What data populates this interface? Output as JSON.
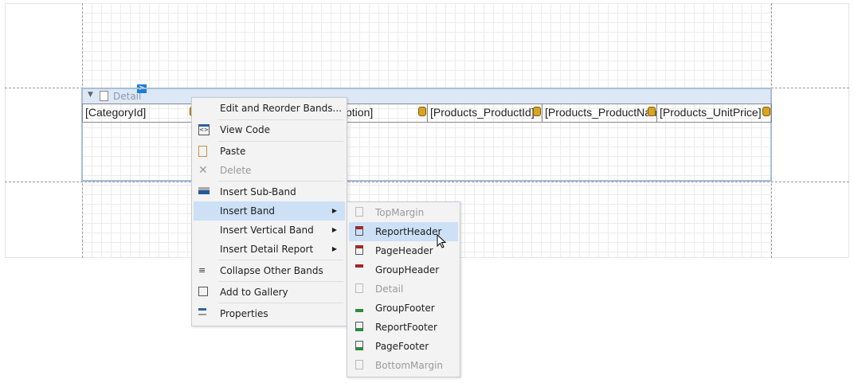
{
  "band": {
    "name": "Detail",
    "collapse_icon": "triangle-down-icon",
    "band_icon": "detail-band-icon",
    "smart_tag": ">"
  },
  "cells": [
    "[CategoryId]",
    "ption]",
    "[Products_ProductId]",
    "[Products_ProductNam",
    "[Products_UnitPrice]"
  ],
  "context_menu": {
    "items": [
      {
        "label": "Edit and Reorder Bands...",
        "icon": ""
      },
      {
        "label": "View Code",
        "icon": "code-icon"
      },
      {
        "label": "Paste",
        "icon": "paste-icon"
      },
      {
        "label": "Delete",
        "icon": "x-icon",
        "disabled": true
      },
      {
        "label": "Insert Sub-Band",
        "icon": "sub-band-icon"
      },
      {
        "label": "Insert Band",
        "submenu": true,
        "highlighted": true
      },
      {
        "label": "Insert Vertical Band",
        "submenu": true
      },
      {
        "label": "Insert Detail Report",
        "submenu": true
      },
      {
        "label": "Collapse Other Bands",
        "icon": "collapse-icon"
      },
      {
        "label": "Add to Gallery",
        "icon": "gallery-icon"
      },
      {
        "label": "Properties",
        "icon": "properties-icon"
      }
    ]
  },
  "submenu": {
    "items": [
      {
        "label": "TopMargin",
        "disabled": true
      },
      {
        "label": "ReportHeader",
        "highlighted": true
      },
      {
        "label": "PageHeader"
      },
      {
        "label": "GroupHeader"
      },
      {
        "label": "Detail",
        "disabled": true
      },
      {
        "label": "GroupFooter"
      },
      {
        "label": "ReportFooter"
      },
      {
        "label": "PageFooter"
      },
      {
        "label": "BottomMargin",
        "disabled": true
      }
    ]
  },
  "colors": {
    "header_red": "#a4262c",
    "footer_green": "#2e8b3a",
    "highlight": "#cce0f6",
    "band_blue": "#dde8f7"
  }
}
